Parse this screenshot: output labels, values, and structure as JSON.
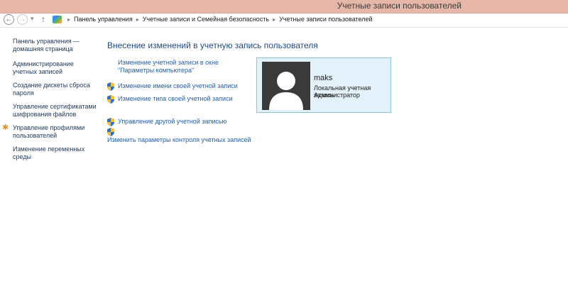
{
  "window": {
    "title": "Учетные записи пользователей"
  },
  "nav": {
    "back_icon": "arrow-left-icon",
    "forward_icon": "arrow-right-icon",
    "up_icon": "arrow-up-icon",
    "breadcrumbs": [
      "Панель управления",
      "Учетные записи и Семейная безопасность",
      "Учетные записи пользователей"
    ]
  },
  "sidebar": {
    "items": [
      {
        "label": "Панель управления — домашняя страница"
      },
      {
        "label": "Администрирование учетных записей"
      },
      {
        "label": "Создание дискеты сброса пароля"
      },
      {
        "label": "Управление сертификатами шифрования файлов"
      },
      {
        "label": "Управление профилями пользователей",
        "icon": "star-icon"
      },
      {
        "label": "Изменение переменных среды"
      }
    ]
  },
  "main": {
    "title": "Внесение изменений в учетную запись пользователя",
    "actions": [
      {
        "label": "Изменение учетной записи в окне \"Параметры компьютера\"",
        "icon": null
      },
      {
        "label": "Изменение имени своей учетной записи",
        "icon": "uac-shield-icon"
      },
      {
        "label": "Изменение типа своей учетной записи",
        "icon": "uac-shield-icon"
      },
      {
        "label": "Управление другой учетной записью",
        "icon": "uac-shield-icon"
      },
      {
        "label": "Изменить параметры контроля учетных записей",
        "icon": "uac-shield-icon"
      }
    ]
  },
  "account": {
    "name": "maks",
    "type": "Локальная учетная запись",
    "role": "Администратор"
  },
  "colors": {
    "titlebar": "#e6b7a8",
    "link": "#1f5fb0",
    "heading": "#1e4a8a",
    "card_bg": "#e3f1fb",
    "card_border": "#86c1e8"
  }
}
